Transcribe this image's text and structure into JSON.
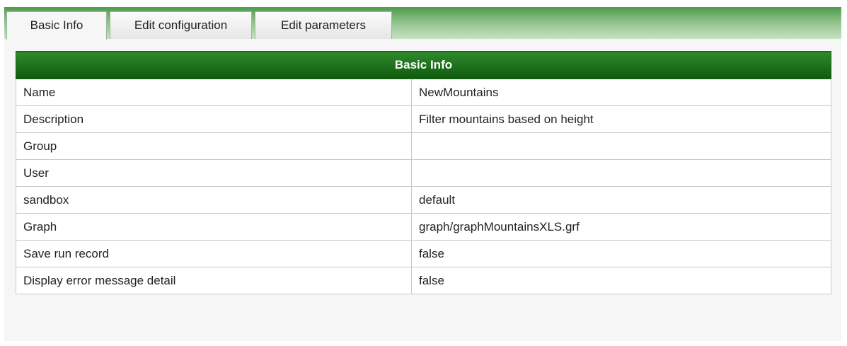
{
  "tabs": [
    {
      "label": "Basic Info",
      "active": true
    },
    {
      "label": "Edit configuration",
      "active": false
    },
    {
      "label": "Edit parameters",
      "active": false
    }
  ],
  "table": {
    "header": "Basic Info",
    "rows": [
      {
        "label": "Name",
        "value": "NewMountains"
      },
      {
        "label": "Description",
        "value": "Filter mountains based on height"
      },
      {
        "label": "Group",
        "value": ""
      },
      {
        "label": "User",
        "value": ""
      },
      {
        "label": "sandbox",
        "value": "default"
      },
      {
        "label": "Graph",
        "value": "graph/graphMountainsXLS.grf"
      },
      {
        "label": "Save run record",
        "value": "false"
      },
      {
        "label": "Display error message detail",
        "value": "false"
      }
    ]
  },
  "colors": {
    "header_green": "#1d6f1b",
    "tabbar_green": "#8ec189",
    "border_gray": "#c9c9c9"
  }
}
